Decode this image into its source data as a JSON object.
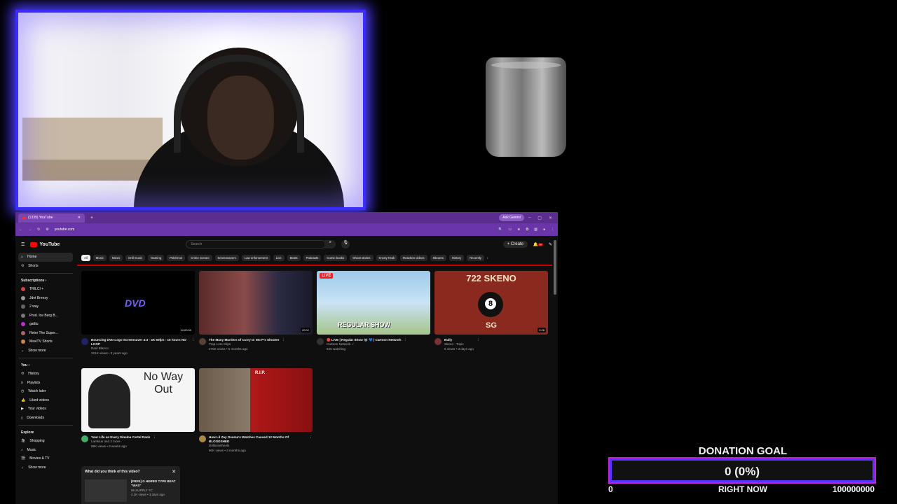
{
  "browser": {
    "tab_title": "(1339) YouTube",
    "gemini_label": "Ask Gemini",
    "url": "youtube.com"
  },
  "youtube": {
    "logo": "YouTube",
    "search_placeholder": "Search",
    "create_label": "+ Create",
    "notif_count": "9+",
    "sidebar": {
      "home": "Home",
      "shorts": "Shorts",
      "subscriptions_head": "Subscriptions",
      "subscriptions": [
        "TRILCI +",
        "Jdot Breezy",
        "2 way",
        "Prod. Ice Berg B...",
        "gatttu",
        "Retro The Super...",
        "MaxiTV Shorts"
      ],
      "show_more": "Show more",
      "you_head": "You",
      "you_items": [
        "History",
        "Playlists",
        "Watch later",
        "Liked videos",
        "Your videos",
        "Downloads"
      ],
      "explore_head": "Explore",
      "explore_items": [
        "Shopping",
        "Music",
        "Movies & TV"
      ],
      "show_more_2": "Show more"
    },
    "chips": [
      "All",
      "Music",
      "Mixes",
      "Drill music",
      "Gaming",
      "Pokémon",
      "Crime scenes",
      "Screensavers",
      "Law enforcement",
      "Live",
      "Beats",
      "Podcasts",
      "Comic books",
      "Ghost stories",
      "Krusty Krab",
      "Reaction videos",
      "Sitcoms",
      "History",
      "Recently"
    ],
    "videos": [
      {
        "title": "Bouncing DVD Logo Screensaver 4:3 - 4K 60fps - 10 hours NO LOOP",
        "channel": "Raúl Blanco",
        "stats": "221K views • 3 years ago",
        "duration": "10:00:00",
        "thumb_text": "DVD"
      },
      {
        "title": "The Many Murders of Curry D: Mo P's Shooter",
        "channel": "Trap Lore Clips",
        "stats": "275K views • 5 months ago",
        "duration": "20:02",
        "thumb_text": ""
      },
      {
        "title": "🔴 LIVE | Regular Show 🦝 💙 | Cartoon Network",
        "channel": "Cartoon Network ✓",
        "stats": "645 watching",
        "duration": "LIVE",
        "thumb_text": "REGULAR SHOW"
      },
      {
        "title": "Bully",
        "channel": "Skeno - Topic",
        "stats": "6 views • 3 days ago",
        "duration": "2:26",
        "thumb_text": "722 SKENO"
      },
      {
        "title": "Your Life as Every Sinaloa Cartel Rank",
        "channel": "Lamkius and 2 more",
        "stats": "99K views • 9 weeks ago",
        "duration": "",
        "thumb_text": "No Way Out"
      },
      {
        "title": "How Lil Zay Osama's Watches Caused 12 Months Of BLOODSHED",
        "channel": "DrillionWheels",
        "stats": "90K views • 3 months ago",
        "duration": "",
        "thumb_text": "R.I.P."
      }
    ],
    "survey": {
      "question": "What did you think of this video?",
      "video_title": "[FREE] G HERBO TYPE BEAT \"WAS\"",
      "video_channel": "86 SUPPLY TC",
      "video_stats": "2.2K views • 3 days ago"
    }
  },
  "donation": {
    "title": "DONATION GOAL",
    "amount": "0 (0%)",
    "progress": 0,
    "min": "0",
    "label": "RIGHT NOW",
    "max": "100000000"
  },
  "colors": {
    "accent_purple": "#5532ff",
    "accent_magenta": "#c21fd6",
    "youtube_red": "#ff0000",
    "browser_purple": "#6a35a8"
  }
}
